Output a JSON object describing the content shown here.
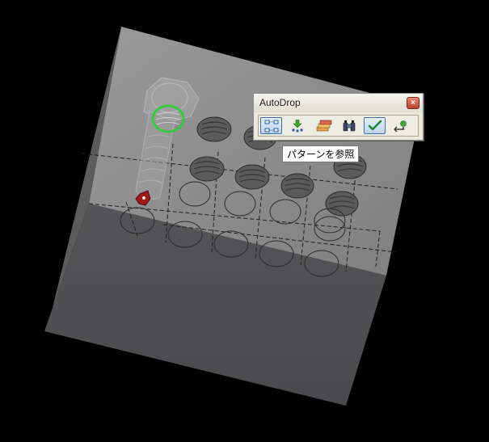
{
  "window": {
    "title": "AutoDrop",
    "close_symbol": "×"
  },
  "toolbar": {
    "buttons": [
      {
        "name": "pattern-reference-button",
        "icon": "pattern-grid-icon",
        "active": true
      },
      {
        "name": "drop-points-button",
        "icon": "drop-arrow-icon",
        "active": false
      },
      {
        "name": "library-button",
        "icon": "stack-library-icon",
        "active": false
      },
      {
        "name": "binocular-button",
        "icon": "binocular-icon",
        "active": false
      },
      {
        "name": "accept-button",
        "icon": "checkmark-icon",
        "active": true
      },
      {
        "name": "connect-button",
        "icon": "connect-arrow-icon",
        "active": false
      }
    ]
  },
  "tooltip": {
    "text": "パターンを参照"
  },
  "colors": {
    "background": "#000000",
    "block_top": "#8c8c8c",
    "block_front": "#4f4f52",
    "highlight_ring": "#27d233",
    "marker": "#a01818"
  }
}
